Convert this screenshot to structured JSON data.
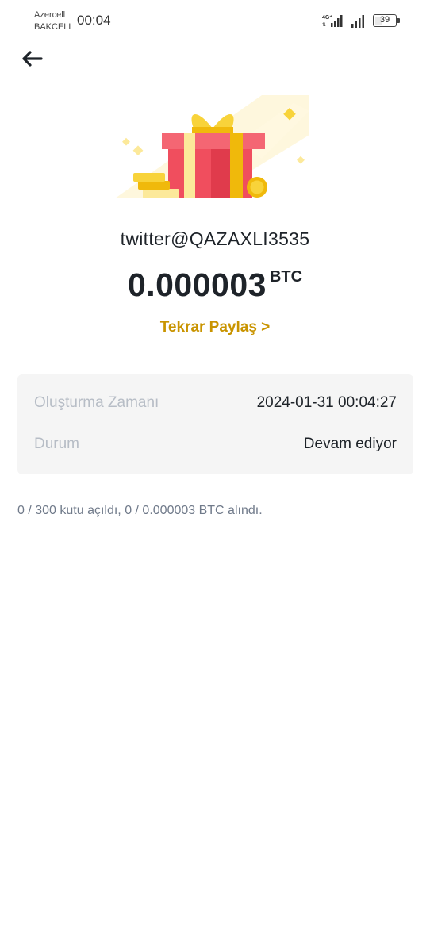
{
  "status_bar": {
    "carrier_1": "Azercell",
    "carrier_2": "BAKCELL",
    "time": "00:04",
    "network_label": "4G",
    "battery_level": "39"
  },
  "header": {
    "back_icon": "arrow-left-icon"
  },
  "gift": {
    "illustration": "gift-box-with-coins",
    "colors": {
      "box_red": "#f04e5e",
      "ribbon_yellow": "#f0b90b",
      "coin": "#f8c629"
    }
  },
  "share": {
    "title": "twitter@QAZAXLI3535",
    "amount": "0.000003",
    "currency": "BTC",
    "share_again_label": "Tekrar Paylaş >"
  },
  "details": {
    "rows": [
      {
        "label": "Oluşturma Zamanı",
        "value": "2024-01-31 00:04:27"
      },
      {
        "label": "Durum",
        "value": "Devam ediyor"
      }
    ]
  },
  "summary": "0 / 300 kutu açıldı, 0 / 0.000003 BTC alındı.",
  "theme": {
    "accent": "#c99400",
    "text": "#1e2329",
    "muted": "#b7bdc6",
    "card_bg": "#f5f5f5"
  }
}
